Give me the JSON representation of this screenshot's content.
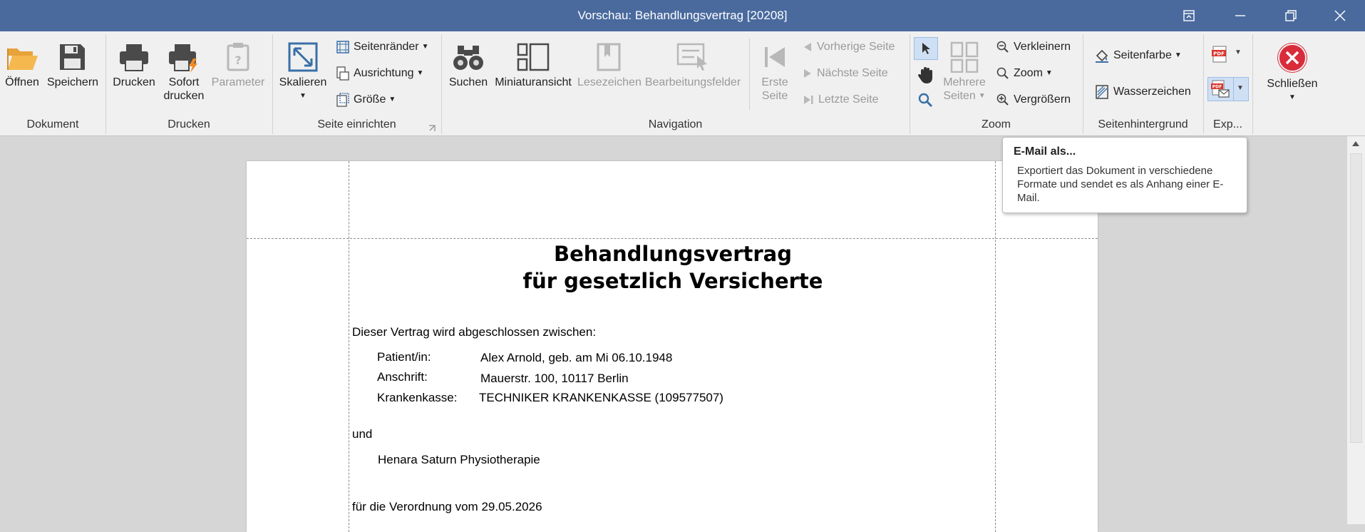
{
  "window": {
    "title": "Vorschau: Behandlungsvertrag [20208]"
  },
  "ribbon": {
    "groups": {
      "dokument": "Dokument",
      "drucken": "Drucken",
      "seite": "Seite einrichten",
      "navigation": "Navigation",
      "zoom": "Zoom",
      "hintergrund": "Seitenhintergrund",
      "export": "Exp..."
    },
    "dokument": {
      "open": "Öffnen",
      "save": "Speichern"
    },
    "drucken": {
      "print": "Drucken",
      "quick_1": "Sofort",
      "quick_2": "drucken",
      "params": "Parameter"
    },
    "seite": {
      "scale": "Skalieren",
      "margins": "Seitenränder",
      "orientation": "Ausrichtung",
      "size": "Größe"
    },
    "navigation": {
      "search": "Suchen",
      "thumbs": "Miniaturansicht",
      "bookmarks": "Lesezeichen",
      "fields": "Bearbeitungsfelder",
      "first_1": "Erste",
      "first_2": "Seite",
      "prev": "Vorherige Seite",
      "next": "Nächste Seite",
      "last": "Letzte Seite"
    },
    "zoom": {
      "multi_1": "Mehrere",
      "multi_2": "Seiten",
      "zoom_out": "Verkleinern",
      "zoom": "Zoom",
      "zoom_in": "Vergrößern"
    },
    "hintergrund": {
      "color": "Seitenfarbe",
      "watermark": "Wasserzeichen"
    },
    "close": "Schließen"
  },
  "tooltip": {
    "title": "E-Mail als...",
    "body": "Exportiert das Dokument in verschiedene Formate und sendet es als Anhang einer E-Mail."
  },
  "document": {
    "title_1": "Behandlungsvertrag",
    "title_2": "für gesetzlich Versicherte",
    "intro": "Dieser Vertrag wird abgeschlossen zwischen:",
    "patient_label": "Patient/in:",
    "patient_value": "Alex Arnold, geb. am Mi 06.10.1948",
    "address_label": "Anschrift:",
    "address_value": "Mauerstr. 100,  10117 Berlin",
    "insurance_label": "Krankenkasse:",
    "insurance_value": "TECHNIKER KRANKENKASSE (109577507)",
    "and": "und",
    "practice": "Henara Saturn Physiotherapie",
    "prescription": "für die Verordnung vom 29.05.2026"
  }
}
